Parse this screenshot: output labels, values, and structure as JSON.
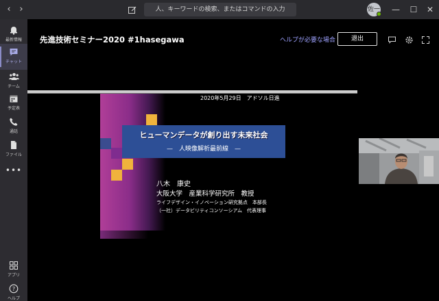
{
  "titlebar": {
    "back_glyph": "‹",
    "forward_glyph": "›",
    "search_placeholder": "人、キーワードの検索、またはコマンドの入力",
    "avatar_initials": "佐一",
    "minimize_glyph": "—",
    "maximize_glyph": "☐",
    "close_glyph": "✕",
    "status_color": "#6bb700"
  },
  "rail": {
    "items": [
      {
        "label": "最新情報",
        "icon": "bell-icon"
      },
      {
        "label": "チャット",
        "icon": "chat-icon",
        "active": true
      },
      {
        "label": "チーム",
        "icon": "teams-icon"
      },
      {
        "label": "予定表",
        "icon": "calendar-icon"
      },
      {
        "label": "通話",
        "icon": "phone-icon"
      },
      {
        "label": "ファイル",
        "icon": "file-icon"
      },
      {
        "label": "•••",
        "icon": "more-icon"
      }
    ],
    "bottom_items": [
      {
        "label": "アプリ",
        "icon": "apps-icon"
      },
      {
        "label": "ヘルプ",
        "icon": "help-icon"
      }
    ],
    "accent_color": "#8b8cc7"
  },
  "meeting": {
    "title": "先進技術セミナー2020 #1hasegawa",
    "help_link": "ヘルプが必要な場合",
    "leave_label": "退出",
    "link_color": "#9ea2ff"
  },
  "slide": {
    "date_line": "2020年5月29日　アドソル日進",
    "title": "ヒューマンデータが創り出す未来社会",
    "subtitle": "—　人映像解析最前線　—",
    "presenter_name": "八木　康史",
    "affiliation": "大阪大学　産業科学研究所　教授",
    "role_1": "ライフデザイン・イノベーション研究拠点　本部長",
    "role_2": "（一社）データビリティコンソーシアム　代表理事",
    "title_box_color": "#2d4f96",
    "band_color": "#b03e98",
    "square_colors": [
      "#f0b33c",
      "#7f2c8f",
      "#3a4c8f"
    ]
  }
}
